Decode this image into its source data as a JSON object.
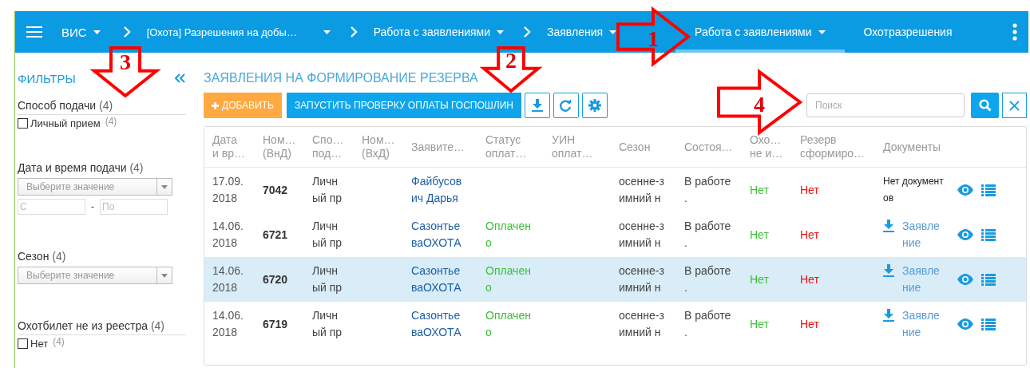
{
  "topbar": {
    "app": "ВИС",
    "breadcrumbs": [
      "[Охота] Разрешения на добы…",
      "Работа с заявлениями",
      "Заявления"
    ],
    "tabs": [
      {
        "label": "Работа с заявлениями",
        "selected": true,
        "dropdown": true
      },
      {
        "label": "Охотразрешения",
        "selected": false,
        "dropdown": false
      }
    ]
  },
  "filters": {
    "title": "ФИЛЬТРЫ",
    "groups": [
      {
        "kind": "checkbox",
        "label": "Способ подачи",
        "count": "(4)",
        "options": [
          {
            "label": "Личный прием",
            "count": "(4)",
            "checked": false
          }
        ]
      },
      {
        "kind": "daterange",
        "label": "Дата и время подачи",
        "count": "(4)",
        "placeholder": "Выберите значение",
        "from_placeholder": "С",
        "separator": "-",
        "to_placeholder": "По"
      },
      {
        "kind": "select",
        "label": "Сезон",
        "count": "(4)",
        "placeholder": "Выберите значение"
      },
      {
        "kind": "checkbox",
        "label": "Охотбилет не из реестра",
        "count": "(4)",
        "options": [
          {
            "label": "Нет",
            "count": "(4)",
            "checked": false
          }
        ]
      }
    ]
  },
  "page_title": "ЗАЯВЛЕНИЯ НА ФОРМИРОВАНИЕ РЕЗЕРВА",
  "toolbar": {
    "add": "ДОБАВИТЬ",
    "check": "ЗАПУСТИТЬ ПРОВЕРКУ ОПЛАТЫ ГОСПОШЛИН",
    "search_placeholder": "Поиск"
  },
  "table": {
    "columns": [
      "Дата\nи вр…",
      "Ном…\n(ВнД)",
      "Спо…\nпод…",
      "Ном…\n(ВхД)",
      "Заявите…",
      "Статус\nоплат…",
      "УИН\nоплат…",
      "Сезон",
      "Состоя…",
      "Охо…\nне и…",
      "Резерв\nсформиро…",
      "Документы"
    ],
    "rows": [
      {
        "selected": false,
        "cells": [
          "17.09.\n2018",
          "7042",
          "Личн\nый пр",
          "",
          "Файбусов\nич Дарья",
          "",
          "",
          "осенне-з\nимний н",
          "В работе\n.",
          "Нет",
          "Нет"
        ],
        "document": {
          "kind": "none",
          "text": "Нет документ\nов"
        }
      },
      {
        "selected": false,
        "cells": [
          "14.06.\n2018",
          "6721",
          "Личн\nый пр",
          "",
          "Сазонтье\nваОХОТА",
          "Оплачен\nо",
          "",
          "осенне-з\nимний н",
          "В работе\n.",
          "Нет",
          "Нет"
        ],
        "document": {
          "kind": "file",
          "text": "Заявле\nние"
        }
      },
      {
        "selected": true,
        "cells": [
          "14.06.\n2018",
          "6720",
          "Личн\nый пр",
          "",
          "Сазонтье\nваОХОТА",
          "Оплачен\nо",
          "",
          "осенне-з\nимний н",
          "В работе\n.",
          "Нет",
          "Нет"
        ],
        "document": {
          "kind": "file",
          "text": "Заявле\nние"
        }
      },
      {
        "selected": false,
        "cells": [
          "14.06.\n2018",
          "6719",
          "Личн\nый пр",
          "",
          "Сазонтье\nваОХОТА",
          "Оплачен\nо",
          "",
          "осенне-з\nимний н",
          "В работе\n.",
          "Нет",
          "Нет"
        ],
        "document": {
          "kind": "file",
          "text": "Заявле\nние"
        }
      }
    ]
  },
  "annotations": [
    {
      "number": "1"
    },
    {
      "number": "2"
    },
    {
      "number": "3"
    },
    {
      "number": "4"
    }
  ]
}
